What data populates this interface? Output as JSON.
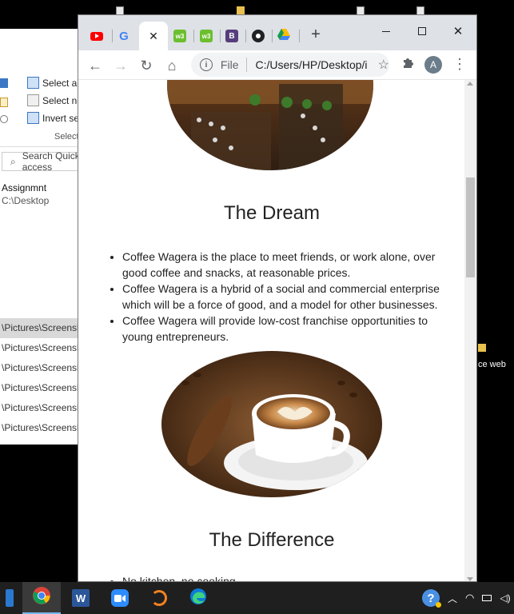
{
  "explorer": {
    "ribbon": {
      "select_all": "Select all",
      "select_none": "Select none",
      "invert_selection": "Invert selection",
      "group_label": "Select"
    },
    "search_placeholder": "Search Quick access",
    "item_name": "Assignmnt",
    "item_path": "C:\\Desktop",
    "rows": [
      "\\Pictures\\Screenshots",
      "\\Pictures\\Screenshots",
      "\\Pictures\\Screenshots",
      "\\Pictures\\Screenshots",
      "\\Pictures\\Screenshots",
      "\\Pictures\\Screenshots"
    ]
  },
  "desktop": {
    "label_right": "ce web"
  },
  "browser": {
    "tabs": [
      {
        "icon": "youtube-icon",
        "color": "#ff0000"
      },
      {
        "icon": "google-icon",
        "color": "#4285f4"
      },
      {
        "icon": "close-icon",
        "color": "#202124"
      },
      {
        "icon": "w3schools-icon",
        "color": "#6cbf2e"
      },
      {
        "icon": "w3schools-icon",
        "color": "#6cbf2e"
      },
      {
        "icon": "bootstrap-icon",
        "color": "#563d7c"
      },
      {
        "icon": "github-icon",
        "color": "#202124"
      },
      {
        "icon": "google-drive-icon",
        "color": "#fbbc04"
      }
    ],
    "omnibox": {
      "scheme": "File",
      "url": "C:/Users/HP/Desktop/index.html"
    },
    "avatar_initial": "A"
  },
  "page": {
    "dream_title": "The Dream",
    "dream_bullets": [
      "Coffee Wagera is the place to meet friends, or work alone, over good coffee and snacks, at reasonable prices.",
      "Coffee Wagera is a hybrid of a social and commercial enterprise which will be a force of good, and a model for other businesses.",
      "Coffee Wagera will provide low-cost franchise opportunities to young entrepreneurs."
    ],
    "difference_title": "The Difference",
    "difference_bullets": [
      "No kitchen, no cooking"
    ]
  },
  "taskbar": {
    "apps": [
      "visual-studio-icon",
      "chrome-icon",
      "word-icon",
      "zoom-icon",
      "eclipse-icon",
      "edge-icon"
    ]
  }
}
